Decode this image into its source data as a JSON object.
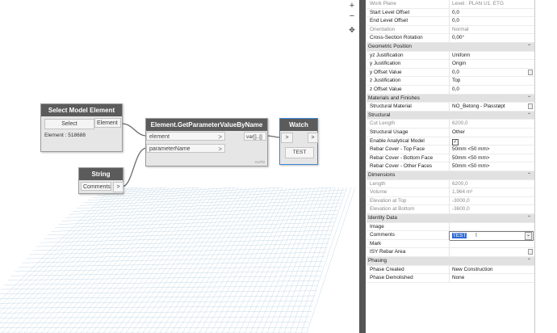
{
  "zoom_controls": {
    "zoom_in": "+",
    "zoom_out": "−",
    "fit": "✥"
  },
  "nodes": {
    "select_model": {
      "title": "Select Model Element",
      "select_button": "Select",
      "output_label": "Element",
      "element_text": "Element : 518688"
    },
    "get_param": {
      "title": "Element.GetParameterValueByName",
      "input1": "element",
      "input2": "parameterName",
      "output": "var[]..[]",
      "lacing": "AUTO"
    },
    "watch": {
      "title": "Watch",
      "value": "TEST"
    },
    "string": {
      "title": "String",
      "value": "Comments",
      "output": ">"
    }
  },
  "properties": {
    "rows": [
      {
        "type": "prop",
        "label": "Work Plane",
        "value": "Level : PLAN U1. ETG",
        "grey": true
      },
      {
        "type": "prop",
        "label": "Start Level Offset",
        "value": "0,0"
      },
      {
        "type": "prop",
        "label": "End Level Offset",
        "value": "0,0"
      },
      {
        "type": "prop",
        "label": "Orientation",
        "value": "Normal",
        "grey": true
      },
      {
        "type": "prop",
        "label": "Cross-Section Rotation",
        "value": "0,00°"
      },
      {
        "type": "group",
        "label": "Geometric Position"
      },
      {
        "type": "prop",
        "label": "yz Justification",
        "value": "Uniform"
      },
      {
        "type": "prop",
        "label": "y Justification",
        "value": "Origin"
      },
      {
        "type": "prop",
        "label": "y Offset Value",
        "value": "0,0",
        "button": true
      },
      {
        "type": "prop",
        "label": "z Justification",
        "value": "Top"
      },
      {
        "type": "prop",
        "label": "z Offset Value",
        "value": "0,0"
      },
      {
        "type": "group",
        "label": "Materials and Finishes"
      },
      {
        "type": "prop",
        "label": "Structural Material",
        "value": "NO_Betong - Plasstøpt",
        "button": true
      },
      {
        "type": "group",
        "label": "Structural"
      },
      {
        "type": "prop",
        "label": "Cut Length",
        "value": "6200,0",
        "grey": true
      },
      {
        "type": "prop",
        "label": "Structural Usage",
        "value": "Other"
      },
      {
        "type": "prop",
        "label": "Enable Analytical Model",
        "value": "✓",
        "check": true
      },
      {
        "type": "prop",
        "label": "Rebar Cover - Top Face",
        "value": "50mm <50 mm>"
      },
      {
        "type": "prop",
        "label": "Rebar Cover - Bottom Face",
        "value": "50mm <50 mm>"
      },
      {
        "type": "prop",
        "label": "Rebar Cover - Other Faces",
        "value": "50mm <50 mm>"
      },
      {
        "type": "group",
        "label": "Dimensions"
      },
      {
        "type": "prop",
        "label": "Length",
        "value": "6200,0",
        "grey": true
      },
      {
        "type": "prop",
        "label": "Volume",
        "value": "1,964 m³",
        "grey": true
      },
      {
        "type": "prop",
        "label": "Elevation at Top",
        "value": "-3000,0",
        "grey": true
      },
      {
        "type": "prop",
        "label": "Elevation at Bottom",
        "value": "-3600,0",
        "grey": true
      },
      {
        "type": "group",
        "label": "Identity Data"
      },
      {
        "type": "prop",
        "label": "Image",
        "value": ""
      },
      {
        "type": "prop",
        "label": "Comments",
        "value": "TEST",
        "selected": true,
        "dropdown": true
      },
      {
        "type": "prop",
        "label": "Mark",
        "value": ""
      },
      {
        "type": "prop",
        "label": "ISY Rebar Area",
        "value": "",
        "button": true
      },
      {
        "type": "group",
        "label": "Phasing"
      },
      {
        "type": "prop",
        "label": "Phase Created",
        "value": "New Construction"
      },
      {
        "type": "prop",
        "label": "Phase Demolished",
        "value": "None"
      }
    ]
  },
  "colors": {
    "node_header": "#5b5b5b",
    "node_body": "#e6e6e6",
    "selection": "#2f6bd6",
    "watch_border": "#3a86d4"
  }
}
